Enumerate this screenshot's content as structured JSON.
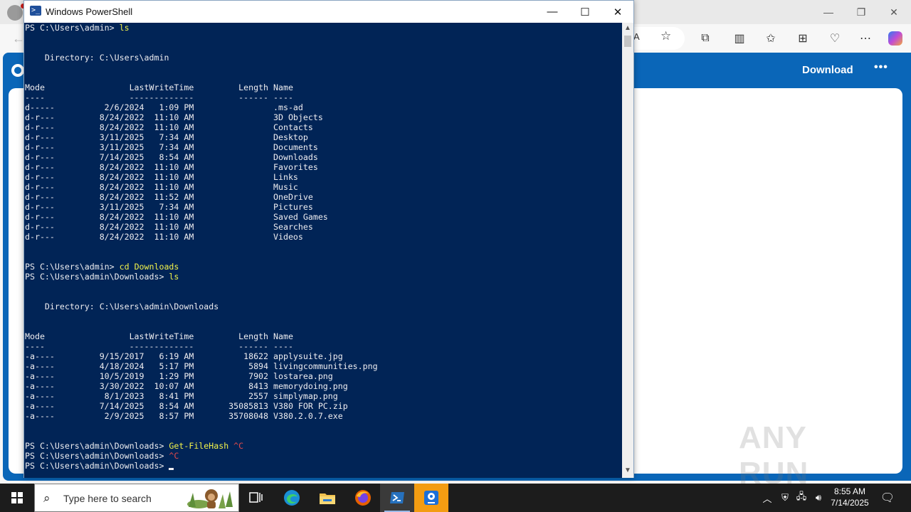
{
  "browser": {
    "read_aloud_label": "A",
    "download_label": "Download",
    "more_label": "•••",
    "minimize": "—",
    "restore": "❐",
    "close": "✕"
  },
  "watermark": "ANY RUN",
  "powershell": {
    "title": "Windows PowerShell",
    "minimize": "—",
    "maximize": "☐",
    "close": "✕",
    "lines": [
      {
        "t": "PS C:\\Users\\admin> ",
        "c": "ls"
      },
      {
        "t": ""
      },
      {
        "t": ""
      },
      {
        "t": "    Directory: C:\\Users\\admin"
      },
      {
        "t": ""
      },
      {
        "t": ""
      },
      {
        "t": "Mode                 LastWriteTime         Length Name"
      },
      {
        "t": "----                 -------------         ------ ----"
      },
      {
        "t": "d-----          2/6/2024   1:09 PM                .ms-ad"
      },
      {
        "t": "d-r---         8/24/2022  11:10 AM                3D Objects"
      },
      {
        "t": "d-r---         8/24/2022  11:10 AM                Contacts"
      },
      {
        "t": "d-r---         3/11/2025   7:34 AM                Desktop"
      },
      {
        "t": "d-r---         3/11/2025   7:34 AM                Documents"
      },
      {
        "t": "d-r---         7/14/2025   8:54 AM                Downloads"
      },
      {
        "t": "d-r---         8/24/2022  11:10 AM                Favorites"
      },
      {
        "t": "d-r---         8/24/2022  11:10 AM                Links"
      },
      {
        "t": "d-r---         8/24/2022  11:10 AM                Music"
      },
      {
        "t": "d-r---         8/24/2022  11:52 AM                OneDrive"
      },
      {
        "t": "d-r---         3/11/2025   7:34 AM                Pictures"
      },
      {
        "t": "d-r---         8/24/2022  11:10 AM                Saved Games"
      },
      {
        "t": "d-r---         8/24/2022  11:10 AM                Searches"
      },
      {
        "t": "d-r---         8/24/2022  11:10 AM                Videos"
      },
      {
        "t": ""
      },
      {
        "t": ""
      },
      {
        "t": "PS C:\\Users\\admin> ",
        "c": "cd Downloads"
      },
      {
        "t": "PS C:\\Users\\admin\\Downloads> ",
        "c": "ls"
      },
      {
        "t": ""
      },
      {
        "t": ""
      },
      {
        "t": "    Directory: C:\\Users\\admin\\Downloads"
      },
      {
        "t": ""
      },
      {
        "t": ""
      },
      {
        "t": "Mode                 LastWriteTime         Length Name"
      },
      {
        "t": "----                 -------------         ------ ----"
      },
      {
        "t": "-a----         9/15/2017   6:19 AM          18622 applysuite.jpg"
      },
      {
        "t": "-a----         4/18/2024   5:17 PM           5894 livingcommunities.png"
      },
      {
        "t": "-a----         10/5/2019   1:29 PM           7902 lostarea.png"
      },
      {
        "t": "-a----         3/30/2022  10:07 AM           8413 memorydoing.png"
      },
      {
        "t": "-a----          8/1/2023   8:41 PM           2557 simplymap.png"
      },
      {
        "t": "-a----         7/14/2025   8:54 AM       35085813 V380 FOR PC.zip"
      },
      {
        "t": "-a----          2/9/2025   8:57 PM       35708048 V380.2.0.7.exe"
      },
      {
        "t": ""
      },
      {
        "t": ""
      },
      {
        "t": "PS C:\\Users\\admin\\Downloads> ",
        "c": "Get-FileHash",
        "x": " ^C"
      },
      {
        "t": "PS C:\\Users\\admin\\Downloads> ",
        "x": "^C"
      },
      {
        "t": "PS C:\\Users\\admin\\Downloads> ",
        "cursor": true
      }
    ]
  },
  "taskbar": {
    "search_placeholder": "Type here to search",
    "apps": [
      "task-view",
      "edge",
      "file-explorer",
      "firefox",
      "powershell",
      "maps"
    ],
    "active_app": "powershell",
    "time": "8:55 AM",
    "date": "7/14/2025"
  }
}
